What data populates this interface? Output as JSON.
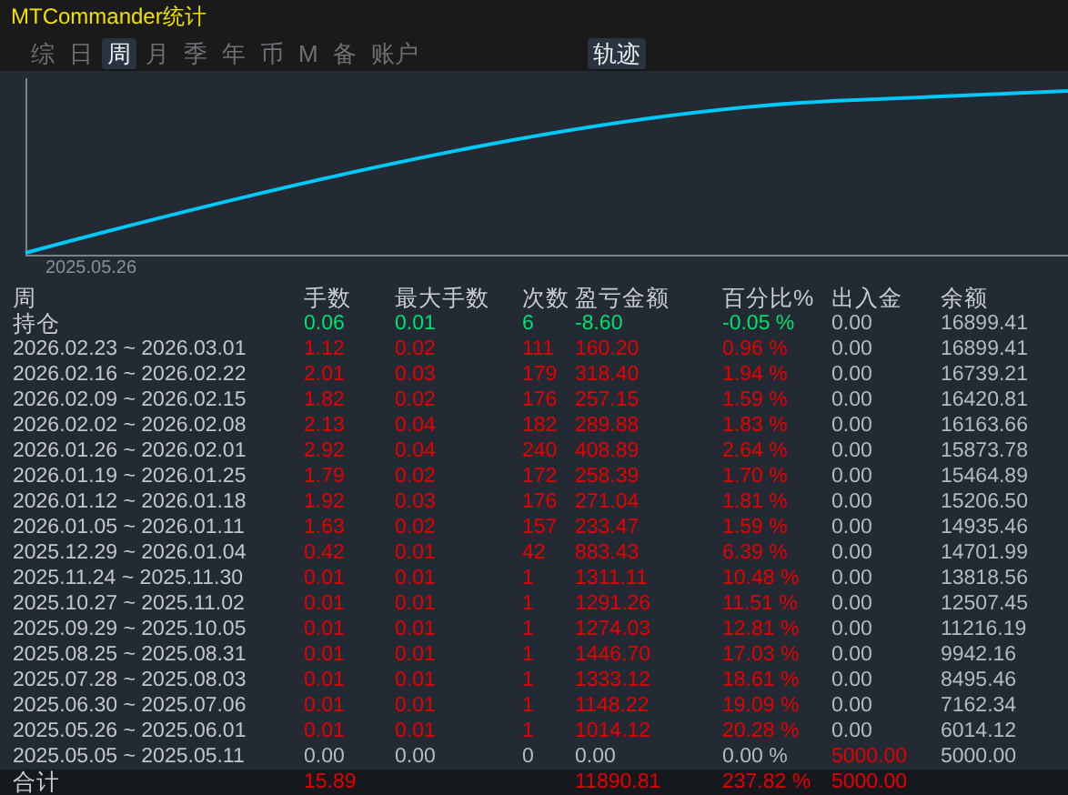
{
  "window": {
    "title": "MTCommander统计"
  },
  "tabs": [
    {
      "label": "综",
      "selected": false
    },
    {
      "label": "日",
      "selected": false
    },
    {
      "label": "周",
      "selected": true
    },
    {
      "label": "月",
      "selected": false
    },
    {
      "label": "季",
      "selected": false
    },
    {
      "label": "年",
      "selected": false
    },
    {
      "label": "币",
      "selected": false
    },
    {
      "label": "M",
      "selected": false
    },
    {
      "label": "备",
      "selected": false
    },
    {
      "label": "账户",
      "selected": false
    }
  ],
  "trace_toggle": {
    "label": "轨迹",
    "on": true
  },
  "chart": {
    "start_label": "2025.05.26"
  },
  "table": {
    "columns": [
      "周",
      "手数",
      "最大手数",
      "次数",
      "盈亏金额",
      "百分比%",
      "出入金",
      "余额"
    ],
    "rows": [
      {
        "kind": "open",
        "cells": [
          "持仓",
          "0.06",
          "0.01",
          "6",
          "-8.60",
          "-0.05 %",
          "0.00",
          "16899.41"
        ]
      },
      {
        "kind": "gain",
        "cells": [
          "2026.02.23 ~ 2026.03.01",
          "1.12",
          "0.02",
          "111",
          "160.20",
          "0.96 %",
          "0.00",
          "16899.41"
        ]
      },
      {
        "kind": "gain",
        "cells": [
          "2026.02.16 ~ 2026.02.22",
          "2.01",
          "0.03",
          "179",
          "318.40",
          "1.94 %",
          "0.00",
          "16739.21"
        ]
      },
      {
        "kind": "gain",
        "cells": [
          "2026.02.09 ~ 2026.02.15",
          "1.82",
          "0.02",
          "176",
          "257.15",
          "1.59 %",
          "0.00",
          "16420.81"
        ]
      },
      {
        "kind": "gain",
        "cells": [
          "2026.02.02 ~ 2026.02.08",
          "2.13",
          "0.04",
          "182",
          "289.88",
          "1.83 %",
          "0.00",
          "16163.66"
        ]
      },
      {
        "kind": "gain",
        "cells": [
          "2026.01.26 ~ 2026.02.01",
          "2.92",
          "0.04",
          "240",
          "408.89",
          "2.64 %",
          "0.00",
          "15873.78"
        ]
      },
      {
        "kind": "gain",
        "cells": [
          "2026.01.19 ~ 2026.01.25",
          "1.79",
          "0.02",
          "172",
          "258.39",
          "1.70 %",
          "0.00",
          "15464.89"
        ]
      },
      {
        "kind": "gain",
        "cells": [
          "2026.01.12 ~ 2026.01.18",
          "1.92",
          "0.03",
          "176",
          "271.04",
          "1.81 %",
          "0.00",
          "15206.50"
        ]
      },
      {
        "kind": "gain",
        "cells": [
          "2026.01.05 ~ 2026.01.11",
          "1.63",
          "0.02",
          "157",
          "233.47",
          "1.59 %",
          "0.00",
          "14935.46"
        ]
      },
      {
        "kind": "gain",
        "cells": [
          "2025.12.29 ~ 2026.01.04",
          "0.42",
          "0.01",
          "42",
          "883.43",
          "6.39 %",
          "0.00",
          "14701.99"
        ]
      },
      {
        "kind": "gain",
        "cells": [
          "2025.11.24 ~ 2025.11.30",
          "0.01",
          "0.01",
          "1",
          "1311.11",
          "10.48 %",
          "0.00",
          "13818.56"
        ]
      },
      {
        "kind": "gain",
        "cells": [
          "2025.10.27 ~ 2025.11.02",
          "0.01",
          "0.01",
          "1",
          "1291.26",
          "11.51 %",
          "0.00",
          "12507.45"
        ]
      },
      {
        "kind": "gain",
        "cells": [
          "2025.09.29 ~ 2025.10.05",
          "0.01",
          "0.01",
          "1",
          "1274.03",
          "12.81 %",
          "0.00",
          "11216.19"
        ]
      },
      {
        "kind": "gain",
        "cells": [
          "2025.08.25 ~ 2025.08.31",
          "0.01",
          "0.01",
          "1",
          "1446.70",
          "17.03 %",
          "0.00",
          "9942.16"
        ]
      },
      {
        "kind": "gain",
        "cells": [
          "2025.07.28 ~ 2025.08.03",
          "0.01",
          "0.01",
          "1",
          "1333.12",
          "18.61 %",
          "0.00",
          "8495.46"
        ]
      },
      {
        "kind": "gain",
        "cells": [
          "2025.06.30 ~ 2025.07.06",
          "0.01",
          "0.01",
          "1",
          "1148.22",
          "19.09 %",
          "0.00",
          "7162.34"
        ]
      },
      {
        "kind": "gain",
        "cells": [
          "2025.05.26 ~ 2025.06.01",
          "0.01",
          "0.01",
          "1",
          "1014.12",
          "20.28 %",
          "0.00",
          "6014.12"
        ]
      },
      {
        "kind": "flat",
        "deposit": true,
        "cells": [
          "2025.05.05 ~ 2025.05.11",
          "0.00",
          "0.00",
          "0",
          "0.00",
          "0.00 %",
          "5000.00",
          "5000.00"
        ]
      }
    ],
    "total": {
      "label": "合计",
      "cells": [
        "15.89",
        "",
        "",
        "11890.81",
        "237.82 %",
        "5000.00",
        ""
      ]
    }
  }
}
